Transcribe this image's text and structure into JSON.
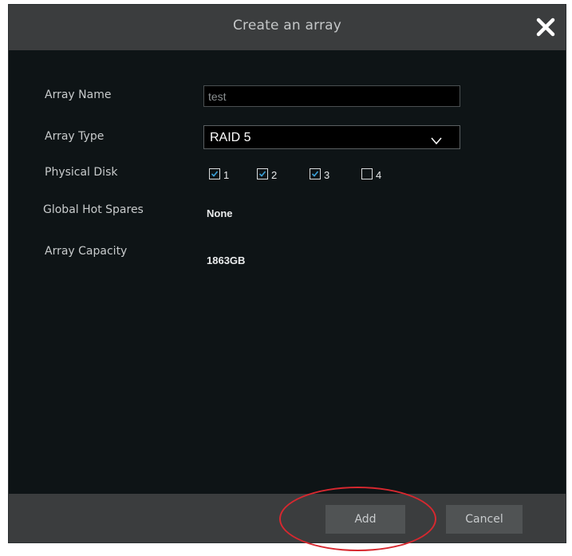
{
  "dialog": {
    "title": "Create an array",
    "close_icon": "close-icon"
  },
  "form": {
    "array_name": {
      "label": "Array Name",
      "value": "test"
    },
    "array_type": {
      "label": "Array Type",
      "value": "RAID 5",
      "icon": "chevron-down-icon"
    },
    "physical_disk": {
      "label": "Physical Disk",
      "disks": [
        {
          "number": "1",
          "checked": true
        },
        {
          "number": "2",
          "checked": true
        },
        {
          "number": "3",
          "checked": true
        },
        {
          "number": "4",
          "checked": false
        }
      ]
    },
    "global_hot_spares": {
      "label": "Global Hot Spares",
      "value": "None"
    },
    "array_capacity": {
      "label": "Array Capacity",
      "value": "1863GB"
    }
  },
  "footer": {
    "add_label": "Add",
    "cancel_label": "Cancel"
  },
  "colors": {
    "dialog_bg": "#0e1416",
    "bar_bg": "#3b3d3e",
    "button_bg": "#505354",
    "checkmark": "#3aa0d8",
    "highlight": "#d7282f"
  }
}
